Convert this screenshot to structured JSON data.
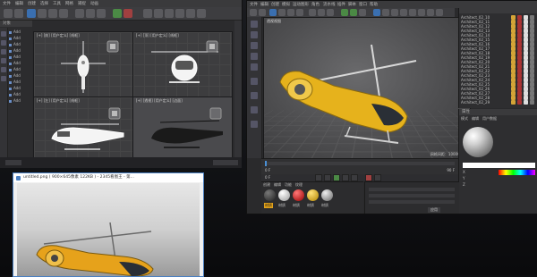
{
  "left_window": {
    "menu": [
      "文件",
      "编辑",
      "创建",
      "选择",
      "工具",
      "网格",
      "捕捉",
      "动画"
    ],
    "panel_header": "对象",
    "objects": [
      "Add",
      "Add",
      "Add",
      "Add",
      "Add",
      "Add",
      "Add",
      "Add",
      "Add",
      "Add",
      "Add",
      "Add"
    ],
    "viewports": [
      {
        "label": "[+] [前] [用户定义] [线框]",
        "kind": "top"
      },
      {
        "label": "[+] [顶] [用户定义] [线框]",
        "kind": "front"
      },
      {
        "label": "[+] [左] [用户定义] [线框]",
        "kind": "left"
      },
      {
        "label": "[+] [透视] [用户定义] [边面]",
        "kind": "persp"
      }
    ]
  },
  "right_window": {
    "menu": [
      "文件",
      "编辑",
      "创建",
      "模拟",
      "运动图形",
      "角色",
      "流水线",
      "插件",
      "脚本",
      "窗口",
      "帮助"
    ],
    "viewport_label": "透视视图",
    "viewport_info": "网格间距：10000 cm",
    "timeline_start": "0 F",
    "timeline_end": "90 F",
    "frame": "0 F",
    "material_tabs": [
      "创建",
      "编辑",
      "功能",
      "纹理"
    ],
    "materials": [
      "材质",
      "材质",
      "材质",
      "材质",
      "材质"
    ],
    "attributes": {
      "head": "属性",
      "tabs": [
        "模式",
        "编辑",
        "用户数据"
      ],
      "field_labels": [
        "X",
        "Y",
        "Z"
      ],
      "apply": "应用"
    },
    "objects": [
      "Architect_02_10",
      "Architect_02_11",
      "Architect_02_12",
      "Architect_02_13",
      "Architect_02_14",
      "Architect_02_15",
      "Architect_02_16",
      "Architect_02_17",
      "Architect_02_18",
      "Architect_02_19",
      "Architect_02_20",
      "Architect_02_21",
      "Architect_02_22",
      "Architect_02_23",
      "Architect_02_24",
      "Architect_02_25",
      "Architect_02_26",
      "Architect_02_27",
      "Architect_02_28",
      "Architect_02_29"
    ],
    "bottom_buttons": [
      "应用"
    ]
  },
  "viewer": {
    "title": "untitled.png ( 900×645像素  122KB ) - 2345看图王 - 第..."
  },
  "colors": {
    "heli_yellow": "#e6b21c",
    "accent_blue": "#4a7fc1"
  }
}
